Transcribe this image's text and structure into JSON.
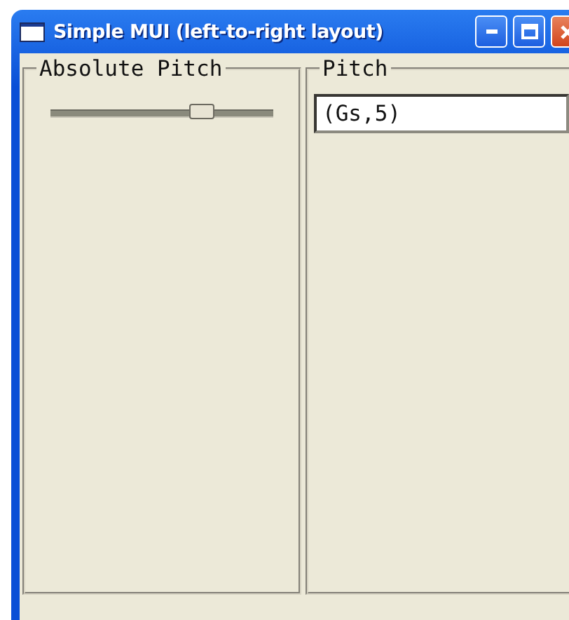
{
  "window": {
    "title": "Simple MUI (left-to-right layout)"
  },
  "groups": [
    {
      "label": "Absolute Pitch",
      "kind": "slider",
      "level": 0.68
    },
    {
      "label": "Pitch",
      "kind": "field",
      "value": "(Gs,5)"
    }
  ]
}
